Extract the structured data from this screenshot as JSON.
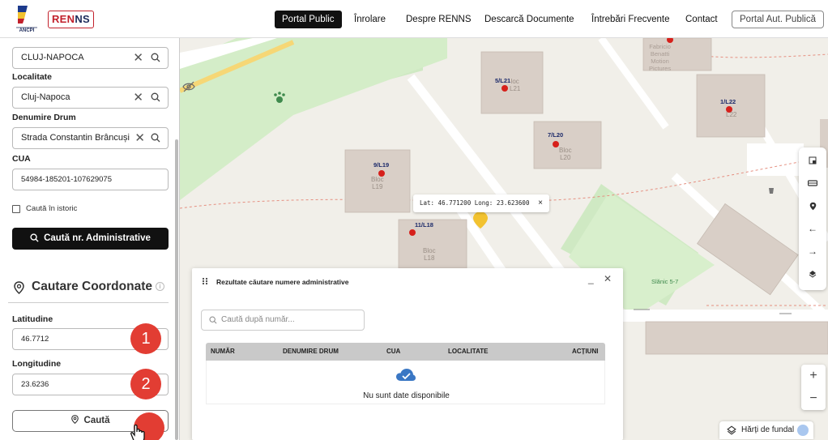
{
  "header": {
    "logo_emblem_text": "ANCPI",
    "logo_text_a": "REN",
    "logo_text_b": "NS",
    "nav": [
      {
        "label": "Portal Public",
        "active": true
      },
      {
        "label": "Înrolare"
      },
      {
        "label": "Despre RENNS"
      },
      {
        "label": "Descarcă Documente"
      },
      {
        "label": "Întrebări Frecvente"
      },
      {
        "label": "Contact"
      },
      {
        "label": "Portal Aut. Publică",
        "outlined": true
      }
    ]
  },
  "left_panel": {
    "uat_value": "CLUJ-NAPOCA",
    "localitate_label": "Localitate",
    "localitate_value": "Cluj-Napoca",
    "drum_label": "Denumire Drum",
    "drum_value": "Strada Constantin Brâncuși",
    "cua_label": "CUA",
    "cua_value": "54984-185201-107629075",
    "istoric_label": "Caută în istoric",
    "search_button": "Caută nr. Administrative",
    "coord_title": "Cautare Coordonate",
    "lat_label": "Latitudine",
    "lat_value": "46.7712",
    "lon_label": "Longitudine",
    "lon_value": "23.6236",
    "search_coord_button": "Caută",
    "badges": [
      "1",
      "2"
    ],
    "icons": [
      "clear-icon",
      "search-icon",
      "pin-icon",
      "info-icon"
    ]
  },
  "map": {
    "buildings": [
      {
        "label": "5/L21",
        "text": "Bloc\nL21"
      },
      {
        "label": "7/L20",
        "text": "Bloc\nL20"
      },
      {
        "label": "9/L19",
        "text": "Bloc\nL19"
      },
      {
        "label": "11/L18",
        "text": "Bloc\nL18"
      },
      {
        "label": "1/L22",
        "text": "L22"
      }
    ],
    "poi_label": "Fabricio Benatti Motion Pictures",
    "park_label": "Slănic 5-7",
    "popup_text": "Lat: 46.771200 Long: 23.623600",
    "popup_close": "×",
    "fundal_label": "Hărți de fundal",
    "zoom_in": "+",
    "zoom_out": "−",
    "controls": [
      "square-select-icon",
      "ruler-icon",
      "location-pin-icon",
      "arrow-left-icon",
      "arrow-right-icon",
      "layers-icon"
    ]
  },
  "results": {
    "title": "Rezultate căutare numere administrative",
    "minimize": "_",
    "close": "✕",
    "search_placeholder": "Caută după număr...",
    "columns": [
      "NUMĂR",
      "DENUMIRE DRUM",
      "CUA",
      "LOCALITATE",
      "ACȚIUNI"
    ],
    "rows": [],
    "empty_text": "Nu sunt date disponibile"
  }
}
